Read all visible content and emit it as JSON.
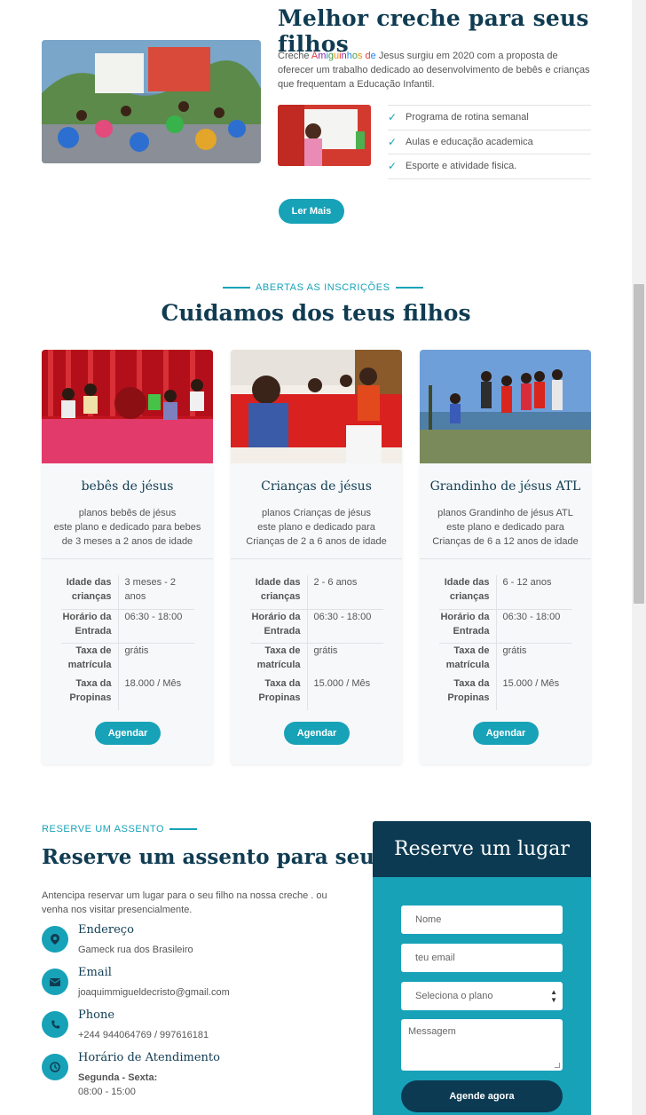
{
  "about": {
    "title": "Melhor creche para seus filhos",
    "brand": [
      "A",
      "m",
      "i",
      "g",
      "u",
      "i",
      "n",
      "h",
      "o",
      "s",
      " ",
      "d",
      "e"
    ],
    "brand_colors": [
      "#e53935",
      "#8e24aa",
      "#1e88e5",
      "#43a047",
      "#fb8c00",
      "#e53935",
      "#8e24aa",
      "#1e88e5",
      "#43a047",
      "#fb8c00",
      "#555555",
      "#e53935",
      "#1e88e5"
    ],
    "text_before": "Creche ",
    "text_after": " Jesus surgiu em 2020 com a proposta de oferecer um trabalho dedicado ao desenvolvimento de bebês e crianças que frequentam a Educação Infantil.",
    "features": [
      "Programa de rotina semanal",
      "Aulas e educação academica",
      "Esporte e atividade fisica."
    ],
    "read_more": "Ler Mais"
  },
  "services": {
    "tag": "ABERTAS AS INSCRIÇÕES",
    "title": "Cuidamos dos teus filhos",
    "cards": [
      {
        "title": "bebês de jésus",
        "desc1": "planos bebês de jésus",
        "desc2": "este plano e dedicado para bebes",
        "desc3": "de 3 meses a 2 anos de idade",
        "rows": [
          {
            "k": "Idade das crianças",
            "v": "3 meses - 2 anos"
          },
          {
            "k": "Horário da Entrada",
            "v": "06:30 - 18:00"
          },
          {
            "k": "Taxa de matrícula",
            "v": "grátis"
          },
          {
            "k": "Taxa da Propinas",
            "v": "18.000 / Mês"
          }
        ],
        "button": "Agendar"
      },
      {
        "title": "Crianças de jésus",
        "desc1": "planos Crianças de jésus",
        "desc2": "este plano e dedicado para",
        "desc3": "Crianças de 2 a 6 anos de idade",
        "rows": [
          {
            "k": "Idade das crianças",
            "v": "2 - 6 anos"
          },
          {
            "k": "Horário da Entrada",
            "v": "06:30 - 18:00"
          },
          {
            "k": "Taxa de matrícula",
            "v": "grátis"
          },
          {
            "k": "Taxa da Propinas",
            "v": "15.000 / Mês"
          }
        ],
        "button": "Agendar"
      },
      {
        "title": "Grandinho de jésus ATL",
        "desc1": "planos Grandinho de jésus ATL",
        "desc2": "este plano e dedicado para",
        "desc3": "Crianças de 6 a 12 anos de idade",
        "rows": [
          {
            "k": "Idade das crianças",
            "v": "6 - 12 anos"
          },
          {
            "k": "Horário da Entrada",
            "v": "06:30 - 18:00"
          },
          {
            "k": "Taxa de matrícula",
            "v": "grátis"
          },
          {
            "k": "Taxa da Propinas",
            "v": "15.000 / Mês"
          }
        ],
        "button": "Agendar"
      }
    ]
  },
  "reserve": {
    "tag": "RESERVE UM ASSENTO",
    "title": "Reserve um assento para seu filho",
    "desc": "Antencipa reservar um lugar para o seu filho na nossa creche . ou venha nos visitar presencialmente.",
    "contacts": [
      {
        "label": "Endereço",
        "value": "Gameck rua dos Brasileiro",
        "icon": "map-pin-icon"
      },
      {
        "label": "Email",
        "value": "joaquimmigueldecristo@gmail.com",
        "icon": "envelope-icon"
      },
      {
        "label": "Phone",
        "value": "+244 944064769 / 997616181",
        "icon": "phone-icon"
      },
      {
        "label": "Horário de Atendimento",
        "value_bold": "Segunda - Sexta:",
        "value": "08:00 - 15:00",
        "icon": "clock-icon"
      }
    ],
    "form": {
      "title": "Reserve um lugar",
      "name_placeholder": "Nome",
      "email_placeholder": "teu email",
      "plan_selected": "Seleciona o plano",
      "message_placeholder": "Messagem",
      "submit": "Agende agora"
    }
  },
  "colors": {
    "accent": "#17a2b8",
    "dark": "#0c3a52",
    "heading": "#103c52"
  }
}
